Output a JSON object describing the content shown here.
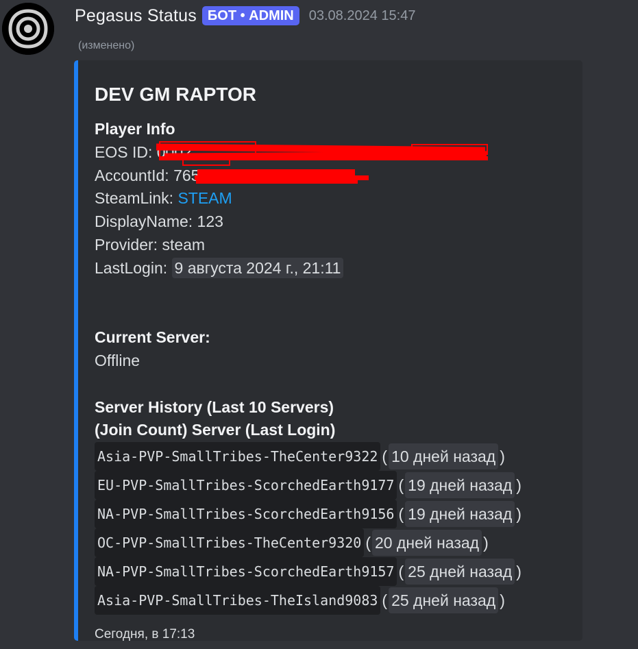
{
  "message": {
    "username": "Pegasus Status",
    "bot_tag": "БОТ • ADMIN",
    "timestamp": "03.08.2024 15:47",
    "edited": "(изменено)"
  },
  "embed": {
    "title": "DEV GM RAPTOR",
    "player_info_label": "Player Info",
    "eos_id_label": "EOS ID: ",
    "eos_id_value": "0002",
    "account_id_label": "AccountId: ",
    "account_id_value": "765",
    "steam_link_label": "SteamLink: ",
    "steam_link_text": "STEAM",
    "display_name_label": "DisplayName: ",
    "display_name_value": "123",
    "provider_label": "Provider: ",
    "provider_value": "steam",
    "last_login_label": "LastLogin: ",
    "last_login_value": "9 августа 2024 г., 21:11",
    "current_server_label": "Current Server:",
    "current_server_value": "Offline",
    "history_title": "Server History (Last 10 Servers)",
    "history_subtitle": "(Join Count) Server (Last Login)",
    "servers": [
      {
        "name": "Asia-PVP-SmallTribes-TheCenter9322",
        "ago": "10 дней назад"
      },
      {
        "name": "EU-PVP-SmallTribes-ScorchedEarth9177",
        "ago": "19 дней назад"
      },
      {
        "name": "NA-PVP-SmallTribes-ScorchedEarth9156",
        "ago": "19 дней назад"
      },
      {
        "name": "OC-PVP-SmallTribes-TheCenter9320",
        "ago": "20 дней назад"
      },
      {
        "name": "NA-PVP-SmallTribes-ScorchedEarth9157",
        "ago": "25 дней назад"
      },
      {
        "name": "Asia-PVP-SmallTribes-TheIsland9083",
        "ago": "25 дней назад"
      }
    ],
    "footer": "Сегодня, в 17:13"
  },
  "colors": {
    "background": "#313338",
    "embed_background": "#2b2d31",
    "embed_accent": "#1e7ff2",
    "bot_tag": "#5865f2",
    "link": "#1ea0f5",
    "redaction": "#ff0000"
  },
  "icons": {
    "avatar": "eye-logo-icon"
  }
}
